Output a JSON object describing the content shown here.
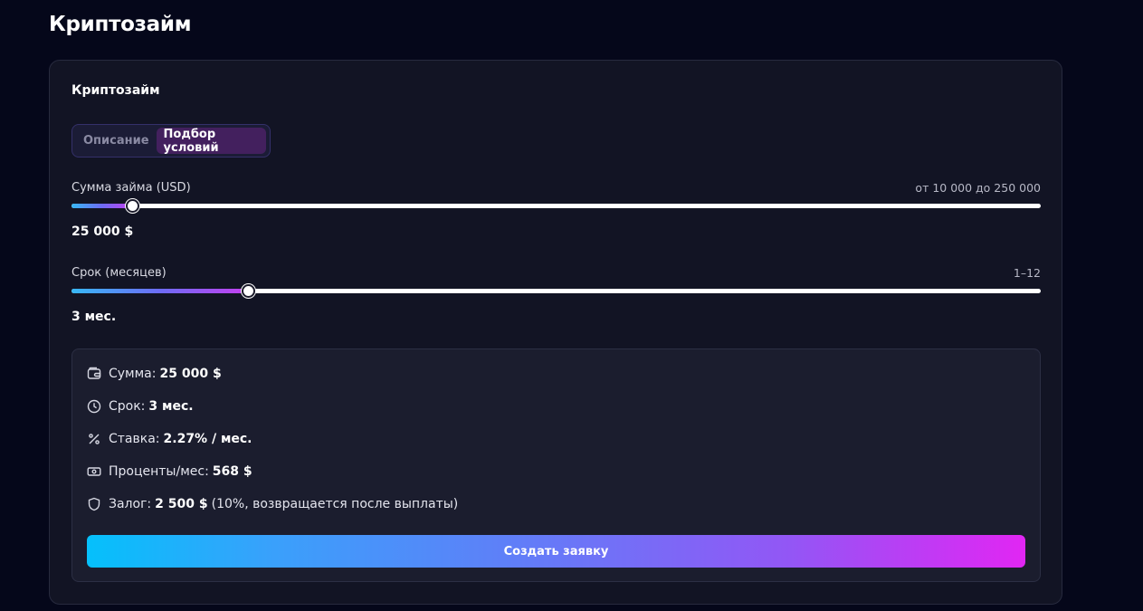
{
  "page": {
    "title": "Криптозайм"
  },
  "card": {
    "title": "Криптозайм"
  },
  "tabs": [
    {
      "label": "Описание",
      "active": false
    },
    {
      "label": "Подбор условий",
      "active": true
    }
  ],
  "amount_slider": {
    "label": "Сумма займа (USD)",
    "range_text": "от 10 000 до 250 000",
    "min": 10000,
    "max": 250000,
    "value": 25000,
    "value_text": "25 000 $"
  },
  "term_slider": {
    "label": "Срок (месяцев)",
    "range_text": "1–12",
    "min": 1,
    "max": 12,
    "value": 3,
    "value_text": "3 мес."
  },
  "summary": {
    "rows": [
      {
        "icon": "wallet-icon",
        "label": "Сумма:",
        "value": "25 000 $",
        "note": ""
      },
      {
        "icon": "clock-icon",
        "label": "Срок:",
        "value": "3 мес.",
        "note": ""
      },
      {
        "icon": "percent-icon",
        "label": "Ставка:",
        "value": "2.27% / мес.",
        "note": ""
      },
      {
        "icon": "banknote-icon",
        "label": "Проценты/мес:",
        "value": "568 $",
        "note": ""
      },
      {
        "icon": "shield-icon",
        "label": "Залог:",
        "value": "2 500 $",
        "note": "(10%, возвращается после выплаты)"
      }
    ],
    "cta_label": "Создать заявку"
  },
  "colors": {
    "background": "#05071a",
    "card": "#121424",
    "tab_active": "#43205e",
    "gradient_start": "#05c0fb",
    "gradient_end": "#e126f3"
  }
}
